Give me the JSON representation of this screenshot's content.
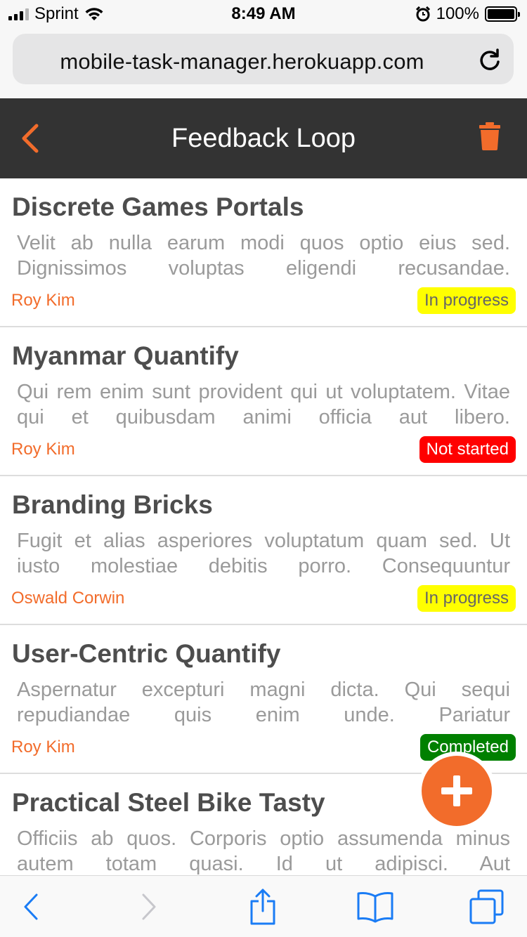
{
  "status_bar": {
    "carrier": "Sprint",
    "time": "8:49 AM",
    "battery": "100%",
    "battery_level": 1.0
  },
  "browser": {
    "url": "mobile-task-manager.herokuapp.com"
  },
  "header": {
    "title": "Feedback Loop"
  },
  "tasks": [
    {
      "title": "Discrete Games Portals",
      "description": "Velit ab nulla earum modi quos optio eius sed. Dignissimos voluptas eligendi recusandae.",
      "owner": "Roy Kim",
      "status": "In progress",
      "status_color": "#ffff00",
      "status_text_color": "#666666"
    },
    {
      "title": "Myanmar Quantify",
      "description": "Qui rem enim sunt provident qui ut voluptatem. Vitae qui et quibusdam animi officia aut libero.",
      "owner": "Roy Kim",
      "status": "Not started",
      "status_color": "#ff0000",
      "status_text_color": "#ffffff"
    },
    {
      "title": "Branding Bricks",
      "description": "Fugit et alias asperiores voluptatum quam sed. Ut iusto molestiae debitis porro. Consequuntur",
      "owner": "Oswald Corwin",
      "status": "In progress",
      "status_color": "#ffff00",
      "status_text_color": "#666666"
    },
    {
      "title": "User-Centric Quantify",
      "description": "Aspernatur excepturi magni dicta. Qui sequi repudiandae quis enim unde. Pariatur",
      "owner": "Roy Kim",
      "status": "Completed",
      "status_color": "#008000",
      "status_text_color": "#ffffff"
    },
    {
      "title": "Practical Steel Bike Tasty",
      "description": "Officiis ab quos. Corporis optio assumenda minus autem totam quasi. Id ut adipisci. Aut",
      "owner": "",
      "status": "",
      "status_color": "",
      "status_text_color": ""
    }
  ],
  "colors": {
    "accent": "#f26c2b",
    "header_bg": "#333333",
    "ios_blue": "#1a7cf5"
  },
  "icons": {
    "back": "chevron-left-icon",
    "delete": "trash-icon",
    "add": "plus-icon",
    "reload": "reload-icon",
    "share": "share-icon",
    "bookmarks": "book-icon",
    "tabs": "tabs-icon"
  }
}
